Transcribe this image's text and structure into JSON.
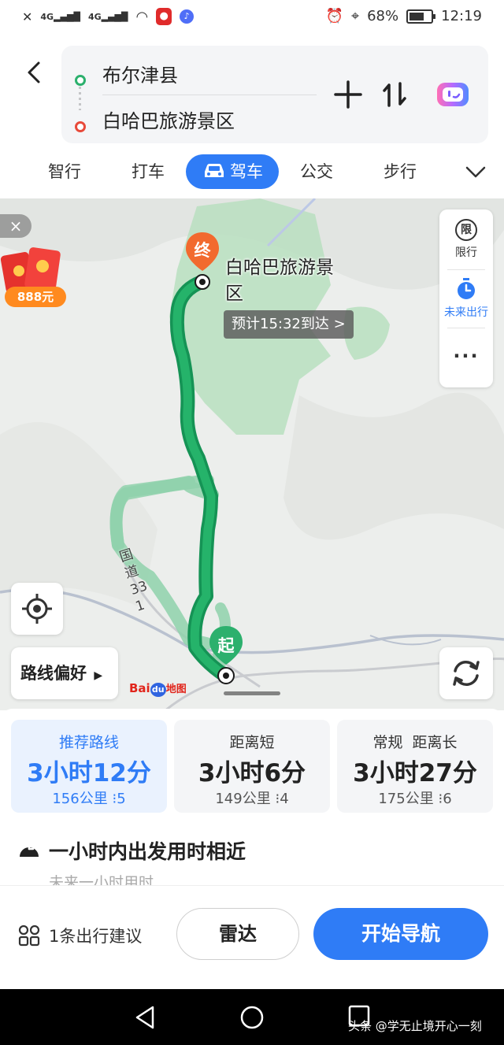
{
  "status_bar": {
    "network_1": "4G",
    "network_2": "4G",
    "battery": "68%",
    "time": "12:19"
  },
  "header": {
    "origin": "布尔津县",
    "destination": "白哈巴旅游景区"
  },
  "modes": [
    "智行",
    "打车",
    "驾车",
    "公交",
    "步行"
  ],
  "active_mode": "驾车",
  "map": {
    "red_packet_amount": "888元",
    "side_panel": {
      "restriction_label": "限行",
      "restriction_icon_char": "限",
      "future_trip_label": "未来出行"
    },
    "end_marker": "终",
    "start_marker": "起",
    "destination_label": "白哈巴旅游景区",
    "eta": "预计15:32到达 >",
    "road_label": "国道331",
    "route_preference": "路线偏好",
    "baidu_logo": {
      "bai": "Bai",
      "du": "du",
      "map": "地图"
    }
  },
  "routes": [
    {
      "label": "推荐路线",
      "time": "3小时12分",
      "distance": "156公里",
      "lights": "5",
      "selected": true
    },
    {
      "label": "距离短",
      "time": "3小时6分",
      "distance": "149公里",
      "lights": "4",
      "selected": false
    },
    {
      "label": "常规  距离长",
      "time": "3小时27分",
      "distance": "175公里",
      "lights": "6",
      "selected": false
    }
  ],
  "tip": {
    "title": "一小时内出发用时相近",
    "subtitle": "未来一小时用时"
  },
  "actions": {
    "advice": "1条出行建议",
    "radar": "雷达",
    "start_nav": "开始导航"
  },
  "watermark": "头条 @学无止境开心一刻",
  "colors": {
    "accent": "#2f7cf6",
    "route_main": "#22a35f",
    "route_alt": "#8fd1ac",
    "marker": "#f26a2e",
    "start": "#2cb06d"
  }
}
